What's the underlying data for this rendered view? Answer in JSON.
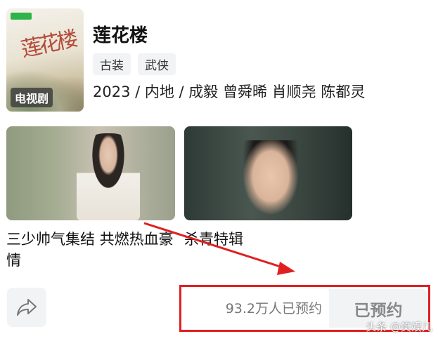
{
  "show": {
    "title": "莲花楼",
    "poster_badge": "电视剧",
    "poster_calligraphy": "莲花楼",
    "tags": [
      "古装",
      "武侠"
    ],
    "meta": "2023 / 内地 / 成毅 曾舜晞 肖顺尧 陈都灵"
  },
  "clips": [
    {
      "caption": "三少帅气集结 共燃热血豪情"
    },
    {
      "caption": "杀青特辑"
    }
  ],
  "actions": {
    "share_icon": "share-arrow-icon",
    "reserve_count": "93.2万人已预约",
    "reserve_button": "已预约"
  },
  "watermark": "头条 @笑娱儿",
  "colors": {
    "annotation_red": "#e02020",
    "button_bg": "#f1f3f5",
    "poster_tag_green": "#2fb34a"
  }
}
